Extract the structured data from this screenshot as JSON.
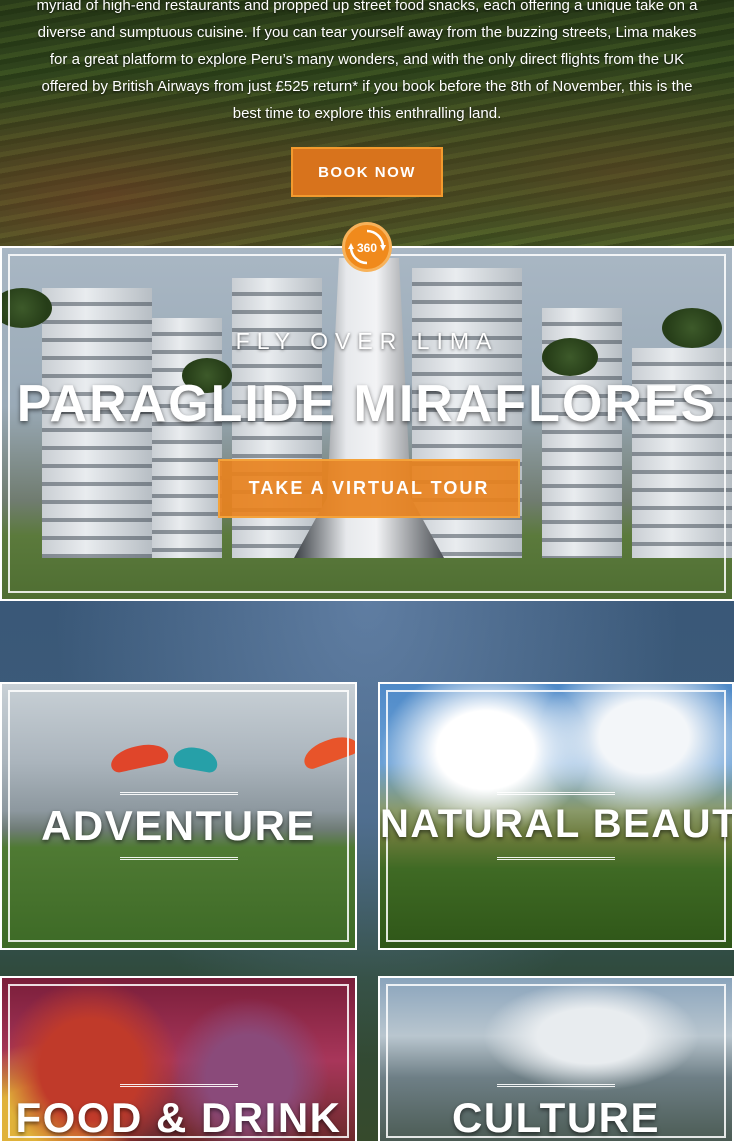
{
  "intro": {
    "paragraph": "myriad of high-end restaurants and propped up street food snacks, each offering a unique take on a diverse and sumptuous cuisine. If you can tear yourself away from the buzzing streets, Lima makes for a great platform to explore Peru’s many wonders, and with the only direct flights from the UK offered by British Airways from just £525 return* if you book before the 8th of November, this is the best time to explore this enthralling land.",
    "book_label": "BOOK NOW"
  },
  "badge": {
    "label": "360",
    "icon": "360-rotate-icon"
  },
  "hero": {
    "subtitle": "FLY OVER LIMA",
    "title": "PARAGLIDE MIRAFLORES",
    "tour_label": "TAKE A VIRTUAL TOUR"
  },
  "tiles": [
    {
      "label": "ADVENTURE"
    },
    {
      "label": "NATURAL BEAUTY"
    },
    {
      "label": "FOOD & DRINK"
    },
    {
      "label": "CULTURE"
    }
  ],
  "colors": {
    "accent": "#e8821e",
    "accent_border": "#f4a23a",
    "text": "#ffffff"
  }
}
